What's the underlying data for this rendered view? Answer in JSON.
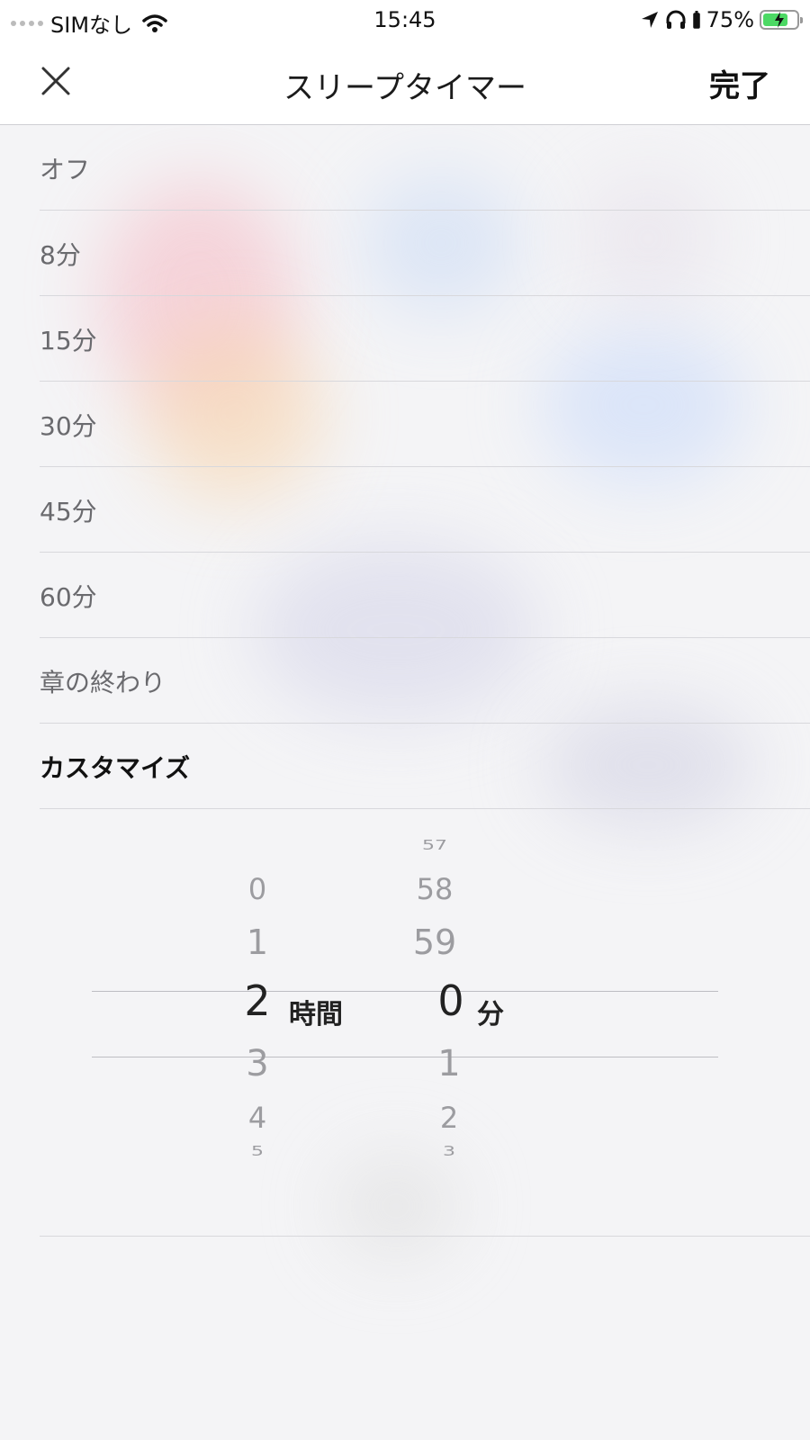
{
  "status_bar": {
    "carrier": "SIMなし",
    "time": "15:45",
    "battery_percent": "75%",
    "battery_level": 0.75,
    "battery_color": "#4cd964",
    "icons": [
      "wifi-icon",
      "location-arrow-icon",
      "headphones-icon",
      "battery-icon"
    ]
  },
  "nav": {
    "title": "スリープタイマー",
    "done_label": "完了",
    "close_icon": "close-icon"
  },
  "options": [
    {
      "label": "オフ"
    },
    {
      "label": "8分"
    },
    {
      "label": "15分"
    },
    {
      "label": "30分"
    },
    {
      "label": "45分"
    },
    {
      "label": "60分"
    },
    {
      "label": "章の終わり"
    },
    {
      "label": "カスタマイズ",
      "selected": true
    }
  ],
  "picker": {
    "hours": {
      "above": [
        "0",
        "1"
      ],
      "selected": "2",
      "below": [
        "3",
        "4",
        "5"
      ],
      "unit": "時間"
    },
    "minutes": {
      "above": [
        "57",
        "58",
        "59"
      ],
      "selected": "0",
      "below": [
        "1",
        "2",
        "3"
      ],
      "unit": "分"
    }
  }
}
